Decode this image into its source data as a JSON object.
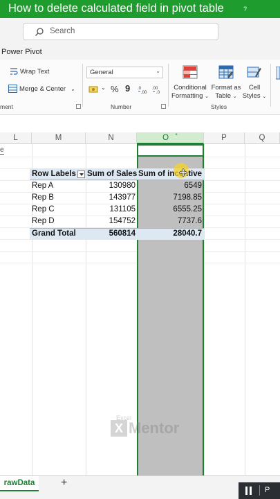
{
  "video_title": "How to delete calculated field in pivot table",
  "video_title_suffix": "?",
  "search": {
    "placeholder": "Search"
  },
  "menu": {
    "power_pivot": "Power Pivot"
  },
  "ribbon": {
    "wrap_text": "Wrap Text",
    "merge_center": "Merge & Center",
    "number_format": "General",
    "alignment_group_fragment": "ment",
    "number_group": "Number",
    "styles_group": "Styles",
    "conditional_formatting": [
      "Conditional",
      "Formatting"
    ],
    "format_as_table": [
      "Format as",
      "Table"
    ],
    "cell_styles": [
      "Cell",
      "Styles"
    ],
    "percent_symbol": "%",
    "comma_symbol": "9"
  },
  "columns": [
    "L",
    "M",
    "N",
    "O",
    "P",
    "Q"
  ],
  "active_cell_marker": "° °",
  "pivot": {
    "header": {
      "row_labels": "Row Labels",
      "sum_of_sales": "Sum of Sales",
      "sum_of_incentive": "Sum of incentive"
    },
    "rows": [
      {
        "label": "Rep A",
        "sales": "130980",
        "incentive": "6549"
      },
      {
        "label": "Rep B",
        "sales": "143977",
        "incentive": "7198.85"
      },
      {
        "label": "Rep C",
        "sales": "131105",
        "incentive": "6555.25"
      },
      {
        "label": "Rep D",
        "sales": "154752",
        "incentive": "7737.6"
      }
    ],
    "total": {
      "label": "Grand Total",
      "sales": "560814",
      "incentive": "28040.7"
    }
  },
  "left_edge_fragment": "e",
  "watermark": {
    "small": "Excel",
    "big": "Mentor",
    "mark": "X"
  },
  "sheet_tabs": [
    "rawData"
  ],
  "add_sheet": "+",
  "player": {
    "label": "P"
  },
  "colors": {
    "accent_green": "#1e7e34",
    "title_bar": "#1f9c2e",
    "pivot_header": "#dde8f3"
  }
}
